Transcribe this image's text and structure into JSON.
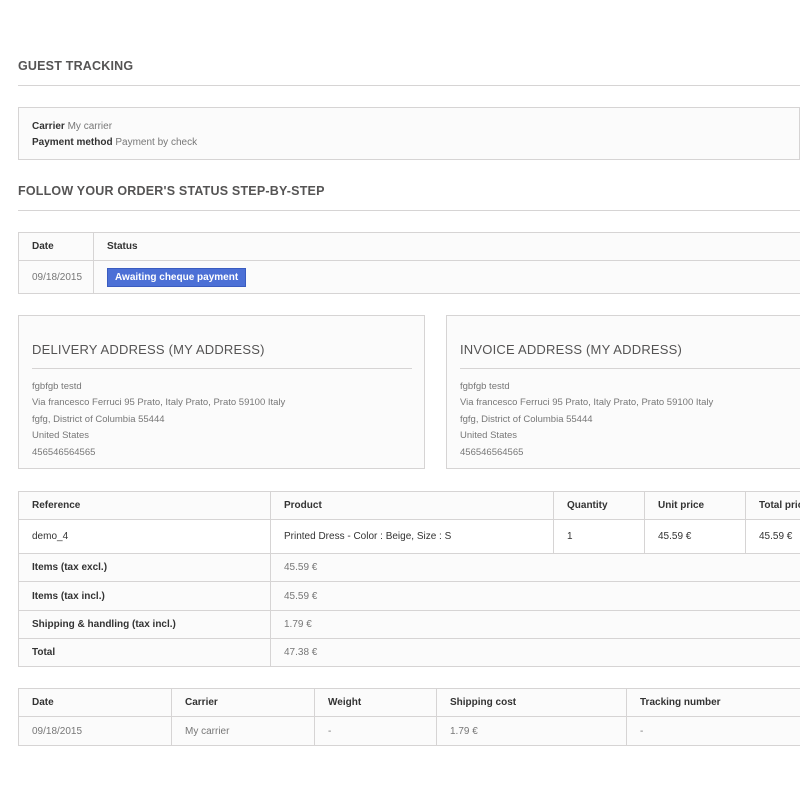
{
  "guest_tracking": {
    "title": "GUEST TRACKING"
  },
  "order_info": {
    "carrier_label": "Carrier",
    "carrier_value": "My carrier",
    "payment_label": "Payment method",
    "payment_value": "Payment by check"
  },
  "follow_status": {
    "title": "FOLLOW YOUR ORDER'S STATUS STEP-BY-STEP",
    "headers": [
      "Date",
      "Status"
    ],
    "rows": [
      {
        "date": "09/18/2015",
        "status": "Awaiting cheque payment"
      }
    ],
    "badge_color": "#4c70d6"
  },
  "delivery_address": {
    "title": "DELIVERY ADDRESS (MY ADDRESS)",
    "lines": [
      "fgbfgb testd",
      "Via francesco Ferruci 95 Prato, Italy Prato, Prato 59100 Italy",
      "fgfg, District of Columbia 55444",
      "United States",
      "456546564565"
    ]
  },
  "invoice_address": {
    "title": "INVOICE ADDRESS (MY ADDRESS)",
    "lines": [
      "fgbfgb testd",
      "Via francesco Ferruci 95 Prato, Italy Prato, Prato 59100 Italy",
      "fgfg, District of Columbia 55444",
      "United States",
      "456546564565"
    ]
  },
  "products": {
    "headers": [
      "Reference",
      "Product",
      "Quantity",
      "Unit price",
      "Total price"
    ],
    "rows": [
      {
        "reference": "demo_4",
        "product": "Printed Dress - Color : Beige, Size : S",
        "quantity": "1",
        "unit_price": "45.59 €",
        "total_price": "45.59 €"
      }
    ],
    "totals": [
      {
        "label": "Items (tax excl.)",
        "value": "45.59 €"
      },
      {
        "label": "Items (tax incl.)",
        "value": "45.59 €"
      },
      {
        "label": "Shipping & handling (tax incl.)",
        "value": "1.79 €"
      },
      {
        "label": "Total",
        "value": "47.38 €"
      }
    ]
  },
  "shipping": {
    "headers": [
      "Date",
      "Carrier",
      "Weight",
      "Shipping cost",
      "Tracking number"
    ],
    "rows": [
      {
        "date": "09/18/2015",
        "carrier": "My carrier",
        "weight": "-",
        "cost": "1.79 €",
        "tracking": "-"
      }
    ]
  }
}
